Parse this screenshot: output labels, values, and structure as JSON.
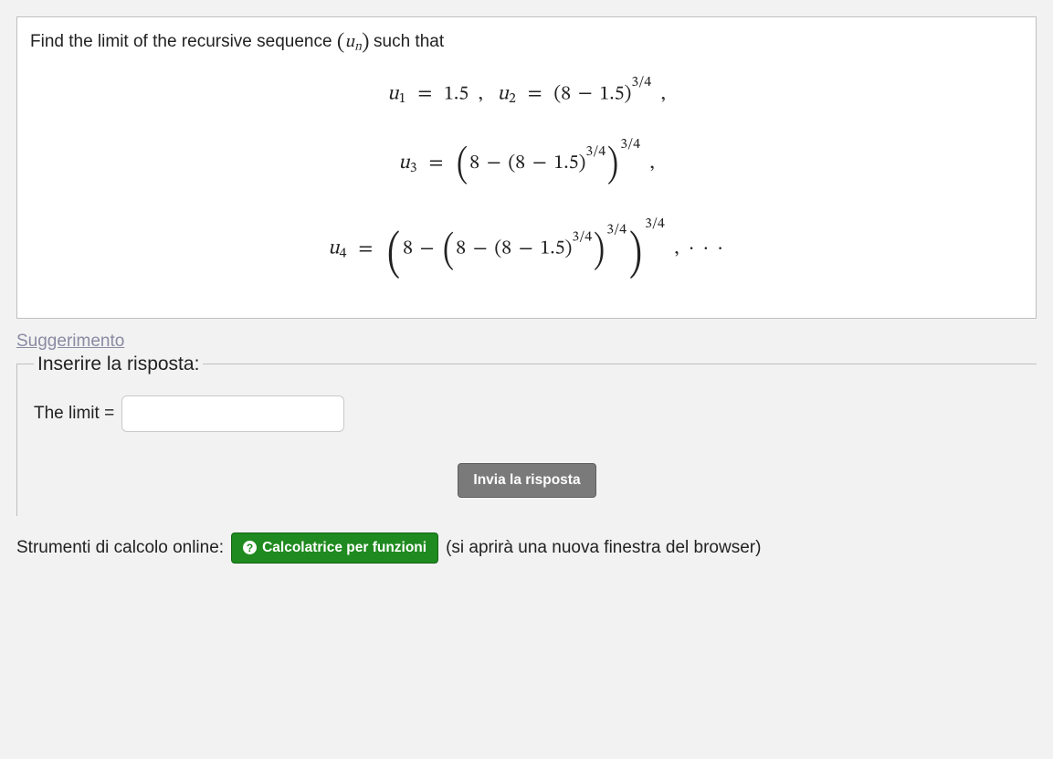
{
  "question": {
    "prompt_before": "Find the limit of the recursive sequence ",
    "prompt_after": " such that",
    "sequence_symbol": {
      "open": "(",
      "u": "u",
      "sub": "n",
      "close": ")"
    }
  },
  "math": {
    "u": "u",
    "eq": "=",
    "minus": "−",
    "comma": ",",
    "dots": "· · ·",
    "val_u1": "1.5",
    "base": "8",
    "inner_const": "1.5",
    "exp": "3/4",
    "idx1": "1",
    "idx2": "2",
    "idx3": "3",
    "idx4": "4"
  },
  "hint": {
    "label": "Suggerimento"
  },
  "answer": {
    "legend": "Inserire la risposta:",
    "label": "The limit =",
    "value": "",
    "submit": "Invia la risposta"
  },
  "tools": {
    "prefix": "Strumenti di calcolo online:",
    "calc_button": "Calcolatrice per funzioni",
    "suffix": "(si aprirà una nuova finestra del browser)"
  }
}
